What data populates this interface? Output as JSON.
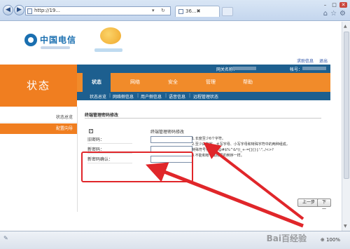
{
  "browser": {
    "tab_title": "36...✖",
    "tab_close": "✕",
    "url": "http://19...",
    "addr_search": "▾",
    "addr_refresh": "↻",
    "win_min": "–",
    "win_max": "□",
    "win_close": "✕",
    "nav_back": "◀",
    "nav_forward": "▶"
  },
  "header": {
    "logo_text": "中国电信",
    "help_link": "求助信息",
    "logout_link": "退出",
    "gateway_label": "网关名称：",
    "account_label": "帐号：",
    "section_title": "状态"
  },
  "main_menu": [
    {
      "label": "状态",
      "active": true
    },
    {
      "label": "网络",
      "active": false
    },
    {
      "label": "安全",
      "active": false
    },
    {
      "label": "管理",
      "active": false
    },
    {
      "label": "帮助",
      "active": false
    }
  ],
  "sub_menu": [
    "状态总览",
    "网络侧信息",
    "用户侧信息",
    "语音信息",
    "远程管理状态"
  ],
  "sub_sep": "|",
  "left_nav": [
    {
      "label": "状态总览",
      "active": false
    },
    {
      "label": "配置向导",
      "active": true
    }
  ],
  "form": {
    "title": "终端管理密码修改",
    "checkbox_mark": "✓",
    "checkbox_label": "终端管理密码修改",
    "old_password_label": "旧密码：",
    "new_password_label": "新密码：",
    "confirm_password_label": "新密码确认：",
    "old_password_value": "",
    "new_password_value": "",
    "confirm_password_value": "",
    "hints": [
      "1.长度至少6个字符。",
      "2.至少由数字、大写字母、小写字母和特殊字符中的两种组成，",
      "特殊符号包括 ~!@#$%^&*()_+-=[]{}|;':\",./<>?",
      "3.不能和帐号或帐号的倒序一样。"
    ],
    "prev_button": "上一步",
    "next_button": "下一步"
  },
  "status_bar": {
    "zoom": "⊕ 100%",
    "watermark": "Bai百经验"
  },
  "colors": {
    "orange": "#f07e20",
    "blue": "#1d5f8f",
    "annotation_red": "#e0262a"
  }
}
